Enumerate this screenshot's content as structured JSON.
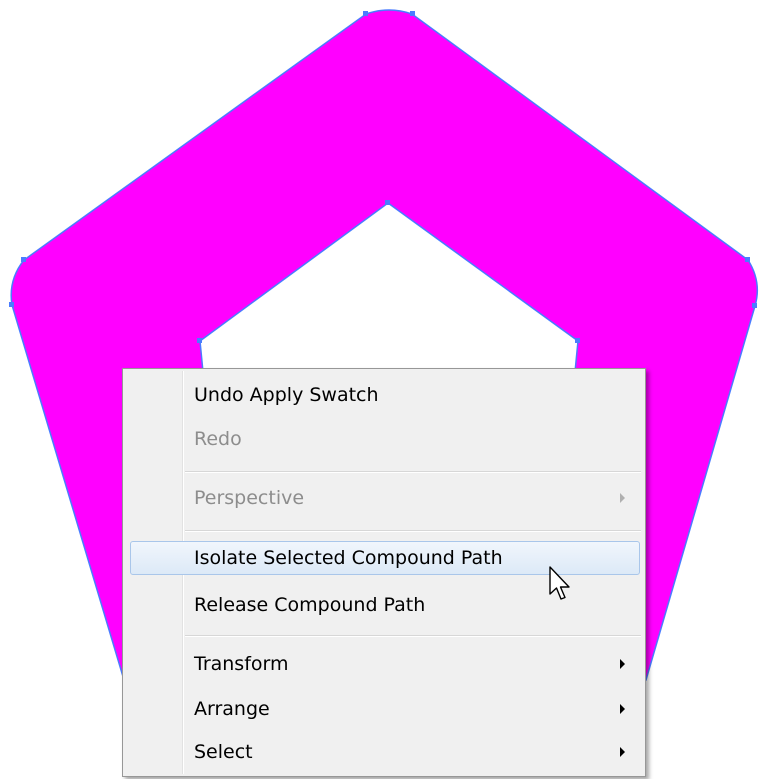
{
  "canvas": {
    "shape": "pentagon-ring",
    "fill_color": "#ff00ff",
    "path_color": "#4a7cff"
  },
  "context_menu": {
    "items": [
      {
        "label": "Undo Apply Swatch",
        "enabled": true,
        "submenu": false
      },
      {
        "label": "Redo",
        "enabled": false,
        "submenu": false
      },
      {
        "label": "Perspective",
        "enabled": false,
        "submenu": true
      },
      {
        "label": "Isolate Selected Compound Path",
        "enabled": true,
        "submenu": false,
        "highlighted": true
      },
      {
        "label": "Release Compound Path",
        "enabled": true,
        "submenu": false
      },
      {
        "label": "Transform",
        "enabled": true,
        "submenu": true
      },
      {
        "label": "Arrange",
        "enabled": true,
        "submenu": true
      },
      {
        "label": "Select",
        "enabled": true,
        "submenu": true
      }
    ]
  },
  "cursor": {
    "icon": "arrow-pointer-icon"
  }
}
